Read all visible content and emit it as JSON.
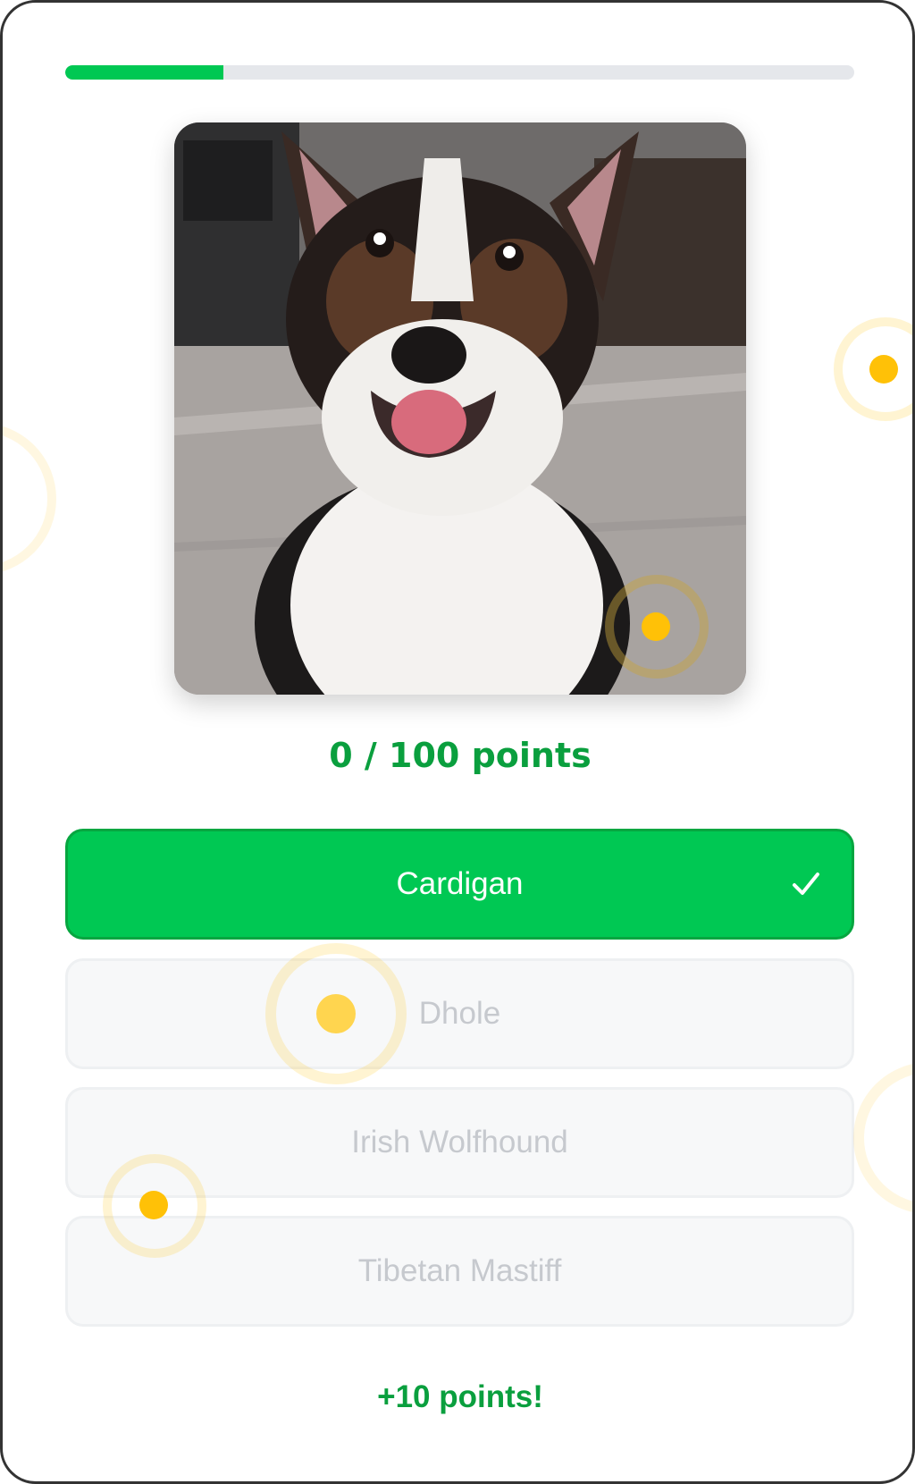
{
  "quiz": {
    "progress": 0.2,
    "score_text": "0 / 100 points",
    "feedback_text": "+10 points!",
    "options": [
      {
        "label": "Cardigan",
        "state": "correct"
      },
      {
        "label": "Dhole",
        "state": "disabled"
      },
      {
        "label": "Irish Wolfhound",
        "state": "disabled"
      },
      {
        "label": "Tibetan Mastiff",
        "state": "disabled"
      }
    ],
    "photo_subject": "dog-photo",
    "check_icon": "check-icon"
  },
  "colors": {
    "accent": "#00c853",
    "accent_text": "#0a9f3e",
    "track": "#e5e7eb",
    "disabled_bg": "#f7f8f9",
    "disabled_text": "#c6c9ce",
    "ring": "#ffc107"
  }
}
